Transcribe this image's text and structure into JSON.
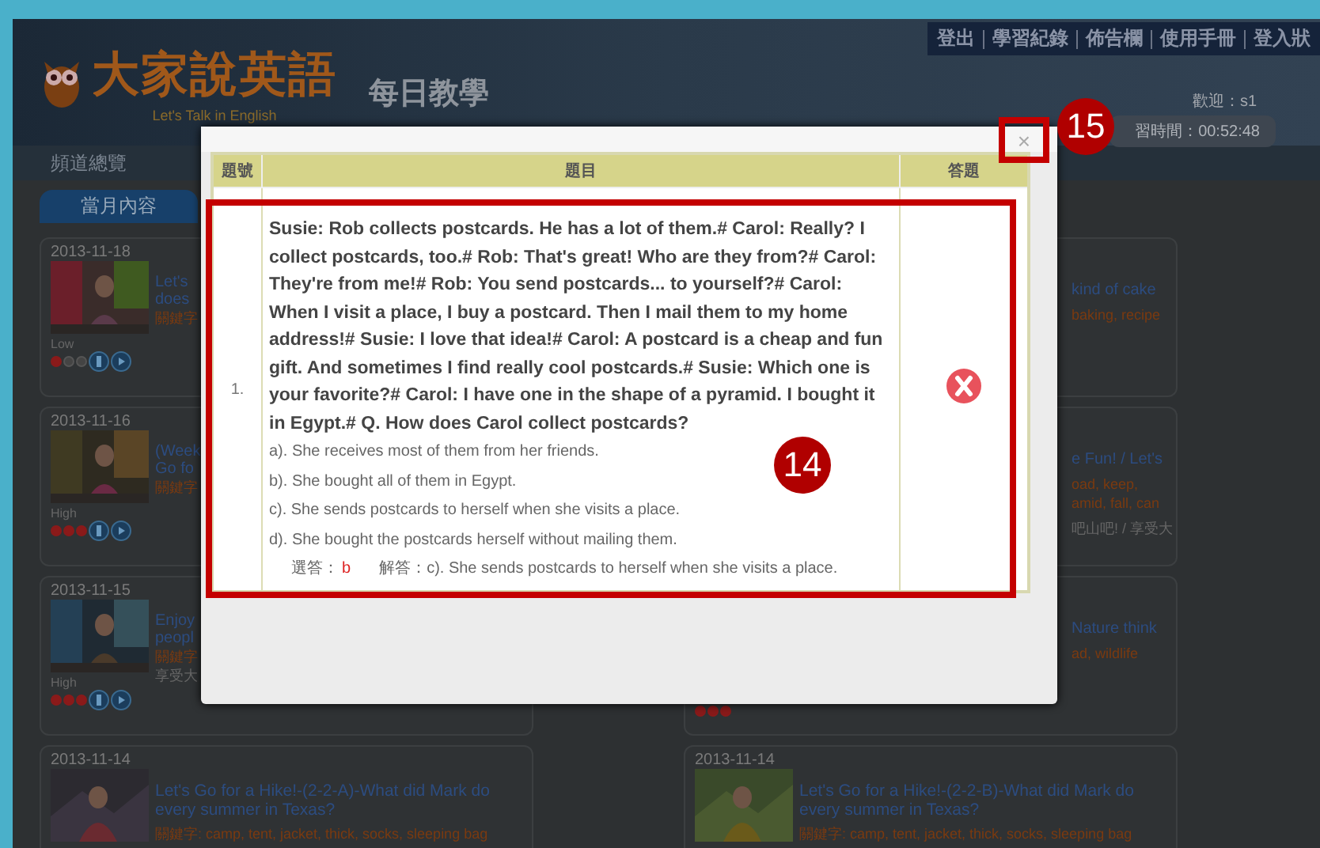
{
  "top_links": [
    "登出",
    "學習紀錄",
    "佈告欄",
    "使用手冊",
    "登入狀"
  ],
  "logo": {
    "title": "大家說英語",
    "subtitle": "Let's Talk in English"
  },
  "section_title": "每日教學",
  "user": {
    "welcome": "歡迎：s1",
    "time": "習時間：00:52:48"
  },
  "nav": [
    "頻道總覽"
  ],
  "month_tab": {
    "label": "當月內容",
    "selected": true
  },
  "cards_left": [
    {
      "date": "2013-11-18",
      "title": [
        "Let's",
        "does"
      ],
      "keywords": "關鍵字",
      "difficulty": "Low",
      "stars": 1
    },
    {
      "date": "2013-11-16",
      "title": [
        "(Week",
        "Go fo"
      ],
      "keywords": "關鍵字",
      "difficulty": "High",
      "stars": 3
    },
    {
      "date": "2013-11-15",
      "title": [
        "Enjoy",
        "peopl"
      ],
      "keywords": "關鍵字",
      "summary": "享受大",
      "difficulty": "High",
      "stars": 3
    }
  ],
  "cards_right": [
    {
      "title": [
        "kind of cake"
      ],
      "keywords": "baking, recipe"
    },
    {
      "title": [
        "e Fun! / Let's"
      ],
      "keywords": "oad, keep, amid, fall, can",
      "summary": "吧山吧! / 享受大"
    },
    {
      "title": [
        "Nature think"
      ],
      "keywords": "ad, wildlife",
      "stars": 3
    }
  ],
  "cards_bottom": [
    {
      "date": "2013-11-14",
      "title": "Let's Go for a Hike!-(2-2-A)-What did Mark do every summer in Texas?",
      "keywords": "關鍵字: camp, tent, jacket, thick, socks, sleeping bag"
    },
    {
      "date": "2013-11-14",
      "title": "Let's Go for a Hike!-(2-2-B)-What did Mark do every summer in Texas?",
      "keywords": "關鍵字: camp, tent, jacket, thick, socks, sleeping bag"
    }
  ],
  "dialog": {
    "close": "×",
    "columns": [
      "題號",
      "題目",
      "答題"
    ],
    "rows": [
      {
        "number": "1.",
        "question": "Susie: Rob collects postcards. He has a lot of them.# Carol: Really? I collect postcards, too.# Rob: That's great! Who are they from?# Carol: They're from me!# Rob: You send postcards... to yourself?# Carol: When I visit a place, I buy a postcard. Then I mail them to my home address!# Susie: I love that idea!# Carol: A postcard is a cheap and fun gift. And sometimes I find really cool postcards.# Susie: Which one is your favorite?# Carol: I have one in the shape of a pyramid. I bought it in Egypt.# Q. How does Carol collect postcards?",
        "options": [
          "a). She receives most of them from her friends.",
          "b). She bought all of them in Egypt.",
          "c). She sends postcards to herself when she visits a place.",
          "d). She bought the postcards herself without mailing them."
        ],
        "chosen_label": "選答：",
        "chosen": "b",
        "solution_label": "解答：",
        "solution": "c). She sends postcards to herself when she visits a place.",
        "correct": false
      }
    ]
  },
  "annotations": [
    {
      "number": "14"
    },
    {
      "number": "15"
    }
  ]
}
